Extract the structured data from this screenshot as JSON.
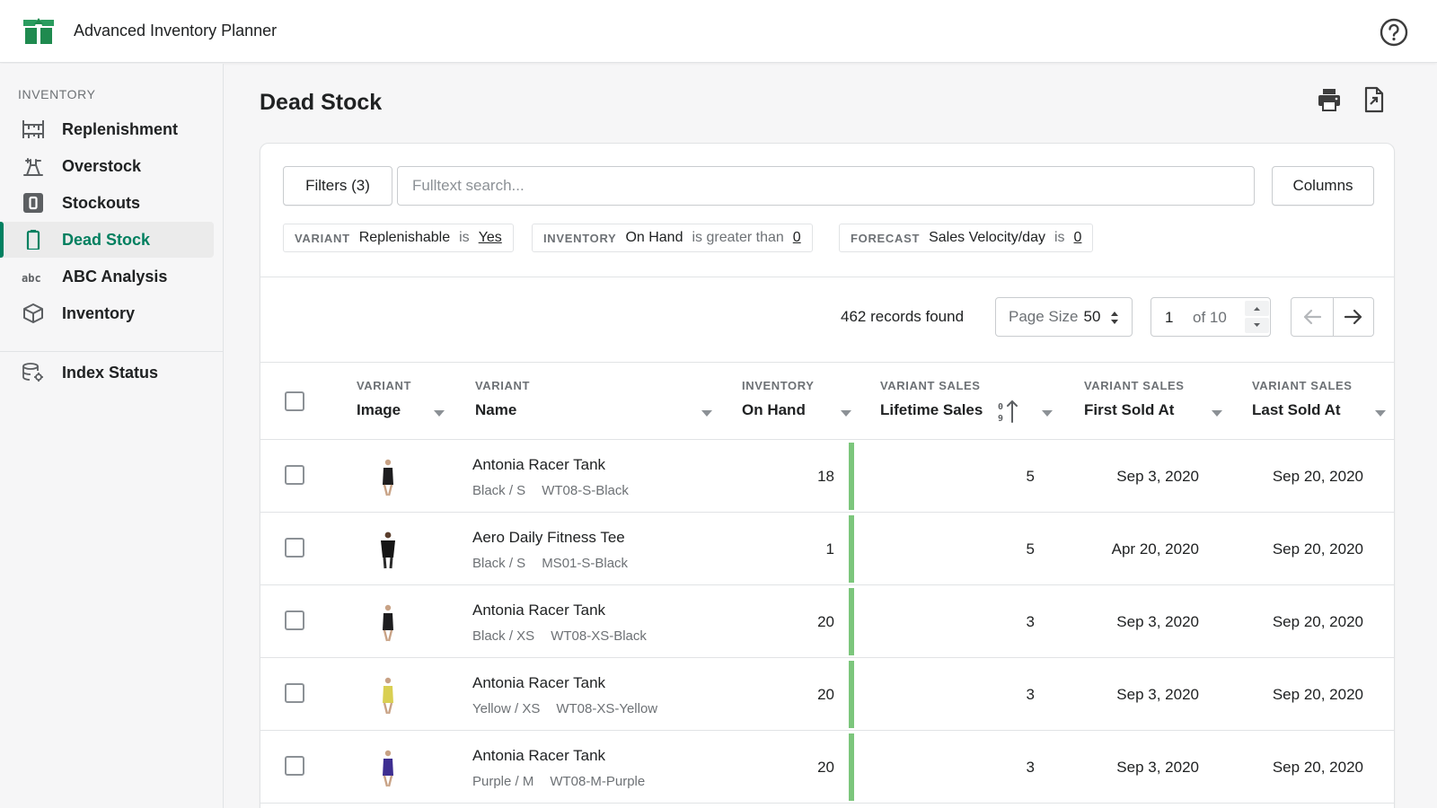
{
  "app": {
    "title": "Advanced Inventory Planner"
  },
  "sidebar": {
    "section": "INVENTORY",
    "items": [
      {
        "label": "Replenishment",
        "icon": "replenishment-icon"
      },
      {
        "label": "Overstock",
        "icon": "overstock-icon"
      },
      {
        "label": "Stockouts",
        "icon": "stockouts-icon"
      },
      {
        "label": "Dead Stock",
        "icon": "dead-stock-icon",
        "active": true
      },
      {
        "label": "ABC Analysis",
        "icon": "abc-icon"
      },
      {
        "label": "Inventory",
        "icon": "box-icon"
      }
    ],
    "footer_items": [
      {
        "label": "Index Status",
        "icon": "database-settings-icon"
      }
    ]
  },
  "page": {
    "title": "Dead Stock"
  },
  "toolbar": {
    "filters_label": "Filters (3)",
    "search_placeholder": "Fulltext search...",
    "columns_label": "Columns"
  },
  "filters": [
    {
      "group": "VARIANT",
      "field": "Replenishable",
      "op": "is",
      "value": "Yes"
    },
    {
      "group": "INVENTORY",
      "field": "On Hand",
      "op": "is greater than",
      "value": "0"
    },
    {
      "group": "FORECAST",
      "field": "Sales Velocity/day",
      "op": "is",
      "value": "0"
    }
  ],
  "pagination": {
    "records": "462 records found",
    "page_size_label": "Page Size",
    "page_size": "50",
    "page": "1",
    "of": "of 10"
  },
  "table": {
    "columns": [
      {
        "group": "VARIANT",
        "name": "Image"
      },
      {
        "group": "VARIANT",
        "name": "Name"
      },
      {
        "group": "INVENTORY",
        "name": "On Hand"
      },
      {
        "group": "VARIANT SALES",
        "name": "Lifetime Sales"
      },
      {
        "group": "VARIANT SALES",
        "name": "First Sold At"
      },
      {
        "group": "VARIANT SALES",
        "name": "Last Sold At"
      }
    ],
    "rows": [
      {
        "name": "Antonia Racer Tank",
        "option": "Black / S",
        "sku": "WT08-S-Black",
        "on_hand": "18",
        "lifetime_sales": "5",
        "first_sold": "Sep 3, 2020",
        "last_sold": "Sep 20, 2020",
        "color": "#1d1d1f"
      },
      {
        "name": "Aero Daily Fitness Tee",
        "option": "Black / S",
        "sku": "MS01-S-Black",
        "on_hand": "1",
        "lifetime_sales": "5",
        "first_sold": "Apr 20, 2020",
        "last_sold": "Sep 20, 2020",
        "color": "#161616"
      },
      {
        "name": "Antonia Racer Tank",
        "option": "Black / XS",
        "sku": "WT08-XS-Black",
        "on_hand": "20",
        "lifetime_sales": "3",
        "first_sold": "Sep 3, 2020",
        "last_sold": "Sep 20, 2020",
        "color": "#1d1d1f"
      },
      {
        "name": "Antonia Racer Tank",
        "option": "Yellow / XS",
        "sku": "WT08-XS-Yellow",
        "on_hand": "20",
        "lifetime_sales": "3",
        "first_sold": "Sep 3, 2020",
        "last_sold": "Sep 20, 2020",
        "color": "#d9cf52"
      },
      {
        "name": "Antonia Racer Tank",
        "option": "Purple / M",
        "sku": "WT08-M-Purple",
        "on_hand": "20",
        "lifetime_sales": "3",
        "first_sold": "Sep 3, 2020",
        "last_sold": "Sep 20, 2020",
        "color": "#3d2e91"
      }
    ]
  },
  "colors": {
    "accent": "#008060",
    "velocity_bar": "#7cc67c",
    "border": "#c9cccf"
  }
}
